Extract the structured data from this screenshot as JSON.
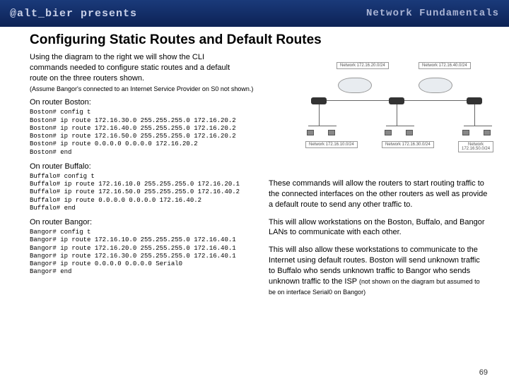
{
  "header": {
    "left": "@alt_bier presents",
    "right": "Network Fundamentals"
  },
  "title": "Configuring Static Routes and Default Routes",
  "intro": "Using the diagram to the right we will show the CLI commands needed to configure static routes and a default route on the three routers shown.",
  "assume_note": "(Assume Bangor's connected to an Internet Service Provider on S0 not shown.)",
  "sections": {
    "boston_label": "On router Boston:",
    "buffalo_label": "On router Buffalo:",
    "bangor_label": "On router Bangor:"
  },
  "cli": {
    "boston": "Boston# config t\nBoston# ip route 172.16.30.0 255.255.255.0 172.16.20.2\nBoston# ip route 172.16.40.0 255.255.255.0 172.16.20.2\nBoston# ip route 172.16.50.0 255.255.255.0 172.16.20.2\nBoston# ip route 0.0.0.0 0.0.0.0 172.16.20.2\nBoston# end",
    "buffalo": "Buffalo# config t\nBuffalo# ip route 172.16.10.0 255.255.255.0 172.16.20.1\nBuffalo# ip route 172.16.50.0 255.255.255.0 172.16.40.2\nBuffalo# ip route 0.0.0.0 0.0.0.0 172.16.40.2\nBuffalo# end",
    "bangor": "Bangor# config t\nBangor# ip route 172.16.10.0 255.255.255.0 172.16.40.1\nBangor# ip route 172.16.20.0 255.255.255.0 172.16.40.1\nBangor# ip route 172.16.30.0 255.255.255.0 172.16.40.1\nBangor# ip route 0.0.0.0 0.0.0.0 Serial0\nBangor# end"
  },
  "paragraphs": {
    "p1": "These commands will allow the routers to start routing traffic to the connected interfaces on the other routers as well as provide a default route to send any other traffic to.",
    "p2": "This will allow workstations on the Boston, Buffalo, and Bangor LANs to communicate with each other.",
    "p3a": "This will also allow these workstations to communicate to the Internet using default routes.  Boston will send unknown traffic to Buffalo who sends unknown traffic to Bangor who sends unknown traffic to the ISP ",
    "p3b": "(not shown on the diagram but assumed to be on interface Serial0 on Bangor)"
  },
  "diagram_labels": {
    "net1": "Network\n172.16.20.0/24",
    "net2": "Network\n172.16.40.0/24",
    "net3": "Network\n172.16.10.0/24",
    "net4": "Network\n172.16.30.0/24",
    "net5": "Network\n172.16.50.0/24"
  },
  "page_number": "69"
}
